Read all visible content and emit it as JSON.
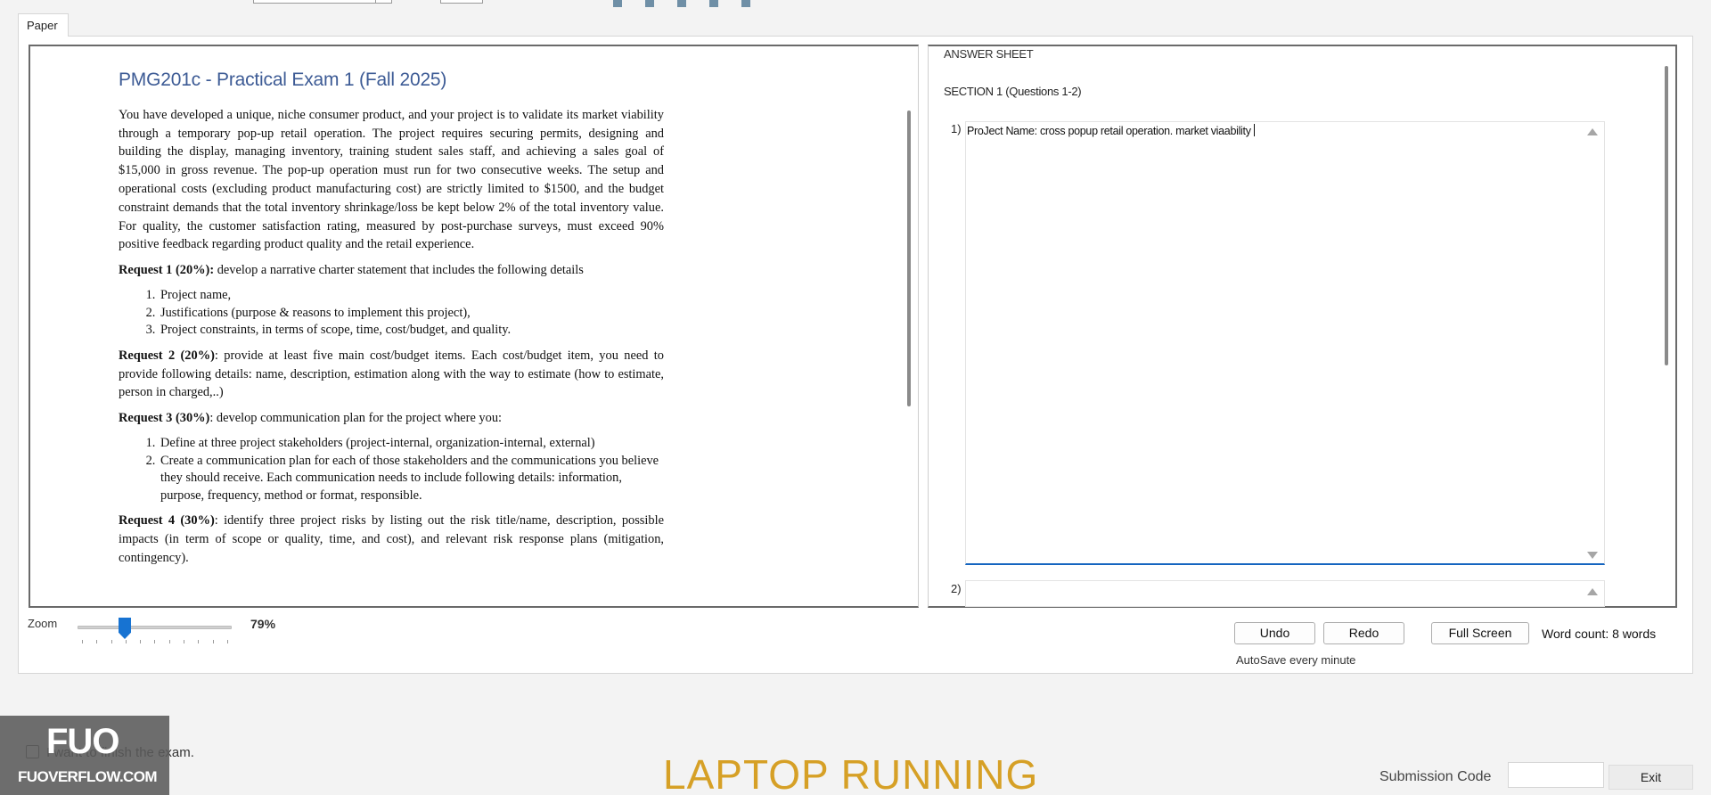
{
  "tab": {
    "label": "Paper"
  },
  "paper": {
    "title": "PMG201c - Practical Exam 1 (Fall 2025)",
    "intro": "You have developed a unique, niche consumer product, and your project is to validate its market viability through a temporary pop-up retail operation. The project requires securing permits, designing and building the display, managing inventory, training student sales staff, and achieving a sales goal of $15,000 in gross revenue. The pop-up operation must run for two consecutive weeks. The setup and operational costs (excluding product manufacturing cost) are strictly limited to $1500, and the budget constraint demands that the total inventory shrinkage/loss be kept below 2% of the total inventory value. For quality, the customer satisfaction rating, measured by post-purchase surveys, must exceed 90% positive feedback regarding product quality and the retail experience.",
    "requests": [
      {
        "heading": "Request 1 (20%):",
        "text": " develop a narrative charter statement that includes the following details",
        "items": [
          "Project name,",
          "Justifications (purpose & reasons to implement this project),",
          "Project constraints, in terms of scope, time, cost/budget, and quality."
        ]
      },
      {
        "heading": "Request 2 (20%)",
        "text": ": provide at least five main cost/budget items. Each cost/budget item, you need to provide following details: name, description, estimation along with the way to estimate (how to estimate, person in charged,..)",
        "items": []
      },
      {
        "heading": "Request 3 (30%)",
        "text": ": develop communication plan for the project where you:",
        "items": [
          "Define at three project stakeholders (project-internal, organization-internal, external)",
          "Create a communication plan for each of those stakeholders and the communications you believe they should receive. Each communication needs to include following details: information, purpose, frequency, method or format, responsible."
        ]
      },
      {
        "heading": "Request 4 (30%)",
        "text": ": identify three project risks by listing out the risk title/name, description, possible impacts (in term of scope or quality, time, and cost), and relevant risk response plans (mitigation, contingency).",
        "items": []
      }
    ]
  },
  "zoom": {
    "label": "Zoom",
    "value": "79%",
    "level_percent": 79
  },
  "answer": {
    "title": "ANSWER SHEET",
    "section": "SECTION 1 (Questions 1-2)",
    "questions": [
      {
        "number": "1)",
        "text": "ProJect Name: cross popup retail operation. market viaability"
      },
      {
        "number": "2)",
        "text": ""
      }
    ]
  },
  "buttons": {
    "undo": "Undo",
    "redo": "Redo",
    "full_screen": "Full Screen"
  },
  "word_count": "Word count:  8 words",
  "autosave": "AutoSave every minute",
  "finish": {
    "label": "I want to finish the exam."
  },
  "watermark": {
    "logo": "FUO",
    "text": "FUOVERFLOW.COM"
  },
  "banner": "LAPTOP RUNNING",
  "submission": {
    "label": "Submission Code",
    "value": ""
  },
  "exit": "Exit"
}
